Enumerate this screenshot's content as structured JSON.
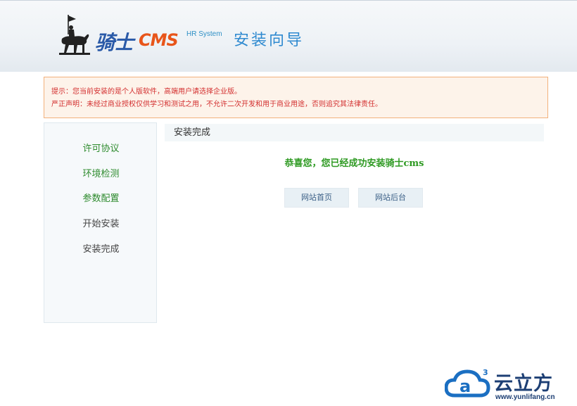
{
  "header": {
    "brand_cn": "骑士",
    "brand_en": "CMS",
    "subtitle": "HR System",
    "title": "安装向导"
  },
  "notice": {
    "line1": "提示：您当前安装的是个人版软件，高端用户请选择企业版。",
    "line2": "严正声明：未经过商业授权仅供学习和测试之用，不允许二次开发和用于商业用途，否则追究其法律责任。"
  },
  "sidebar": {
    "items": [
      {
        "label": "许可协议",
        "state": "done"
      },
      {
        "label": "环境检测",
        "state": "done"
      },
      {
        "label": "参数配置",
        "state": "done"
      },
      {
        "label": "开始安装",
        "state": "pending"
      },
      {
        "label": "安装完成",
        "state": "pending"
      }
    ]
  },
  "main": {
    "heading": "安装完成",
    "message": "恭喜您，您已经成功安装骑士cms",
    "buttons": {
      "home": "网站首页",
      "admin": "网站后台"
    }
  },
  "watermark": {
    "superscript": "3",
    "name": "云立方",
    "url": "www.yunlifang.cn"
  },
  "colors": {
    "notice_text": "#d32f2f",
    "notice_bg": "#fdf3ea",
    "notice_border": "#f2b17c",
    "step_done": "#2e8b2e",
    "success": "#2e9a22",
    "title_blue": "#2f8ad0",
    "brand_orange": "#e8551a"
  },
  "icons": {
    "logo": "knight-on-horse-icon",
    "watermark": "cloud-logo-icon"
  }
}
